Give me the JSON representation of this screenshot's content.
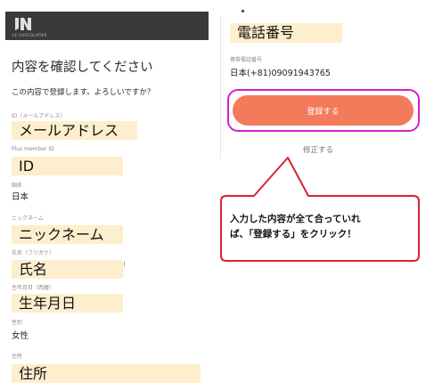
{
  "header": {
    "logo_text": "LE CHOCOLATIER"
  },
  "confirm": {
    "title": "内容を確認してください",
    "subtitle": "この内容で登録します。よろしいですか？"
  },
  "fields": {
    "email": {
      "label": "ID（メールアドレス）",
      "value": "メールアドレス"
    },
    "plus_id": {
      "label": "Plus member ID",
      "value": "ID"
    },
    "country": {
      "label": "国名",
      "value": "日本"
    },
    "nickname": {
      "label": "ニックネーム",
      "value": "ニックネーム"
    },
    "name": {
      "label": "氏名（フリガナ）",
      "value": "氏名"
    },
    "birthday": {
      "label": "生年月日（西暦）",
      "value": "生年月日"
    },
    "gender": {
      "label": "性別",
      "value": "女性"
    },
    "address": {
      "label": "住所",
      "value": "住所"
    }
  },
  "phone": {
    "heading": "電話番号",
    "label": "携帯電話番号",
    "value": "日本(+81)09091943765"
  },
  "actions": {
    "register_label": "登録する",
    "edit_label": "修正する"
  },
  "callout": {
    "line1": "入力した内容が全て合っていれ",
    "line2": "ば、「登録する」をクリック！"
  },
  "colors": {
    "highlight": "#fdeecd",
    "button": "#f47a5c",
    "frame": "#d21fcc",
    "callout_border": "#d8242c",
    "header": "#3a3a3a"
  }
}
